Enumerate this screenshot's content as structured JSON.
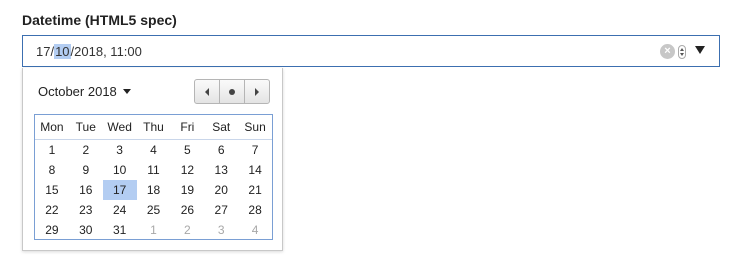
{
  "field": {
    "label": "Datetime (HTML5 spec)",
    "value_prefix": "17/",
    "value_selected_segment": "10",
    "value_suffix": "/2018, 11:00",
    "clear_icon": "clear-icon",
    "clear_glyph": "×",
    "spinner_icon": "spinner-icon",
    "dropdown_icon": "dropdown-arrow-icon"
  },
  "calendar": {
    "month_label": "October 2018",
    "nav": {
      "prev_icon": "previous-month-icon",
      "today_icon": "today-icon",
      "next_icon": "next-month-icon"
    },
    "weekdays": [
      "Mon",
      "Tue",
      "Wed",
      "Thu",
      "Fri",
      "Sat",
      "Sun"
    ],
    "weeks": [
      [
        "1",
        "2",
        "3",
        "4",
        "5",
        "6",
        "7"
      ],
      [
        "8",
        "9",
        "10",
        "11",
        "12",
        "13",
        "14"
      ],
      [
        "15",
        "16",
        "17",
        "18",
        "19",
        "20",
        "21"
      ],
      [
        "22",
        "23",
        "24",
        "25",
        "26",
        "27",
        "28"
      ],
      [
        "29",
        "30",
        "31",
        "1",
        "2",
        "3",
        "4"
      ]
    ],
    "selected_day": "17",
    "colors": {
      "selection": "#b3cdf2",
      "focus_border": "#3c6fb0",
      "other_month_text": "#a8a8a8"
    }
  }
}
